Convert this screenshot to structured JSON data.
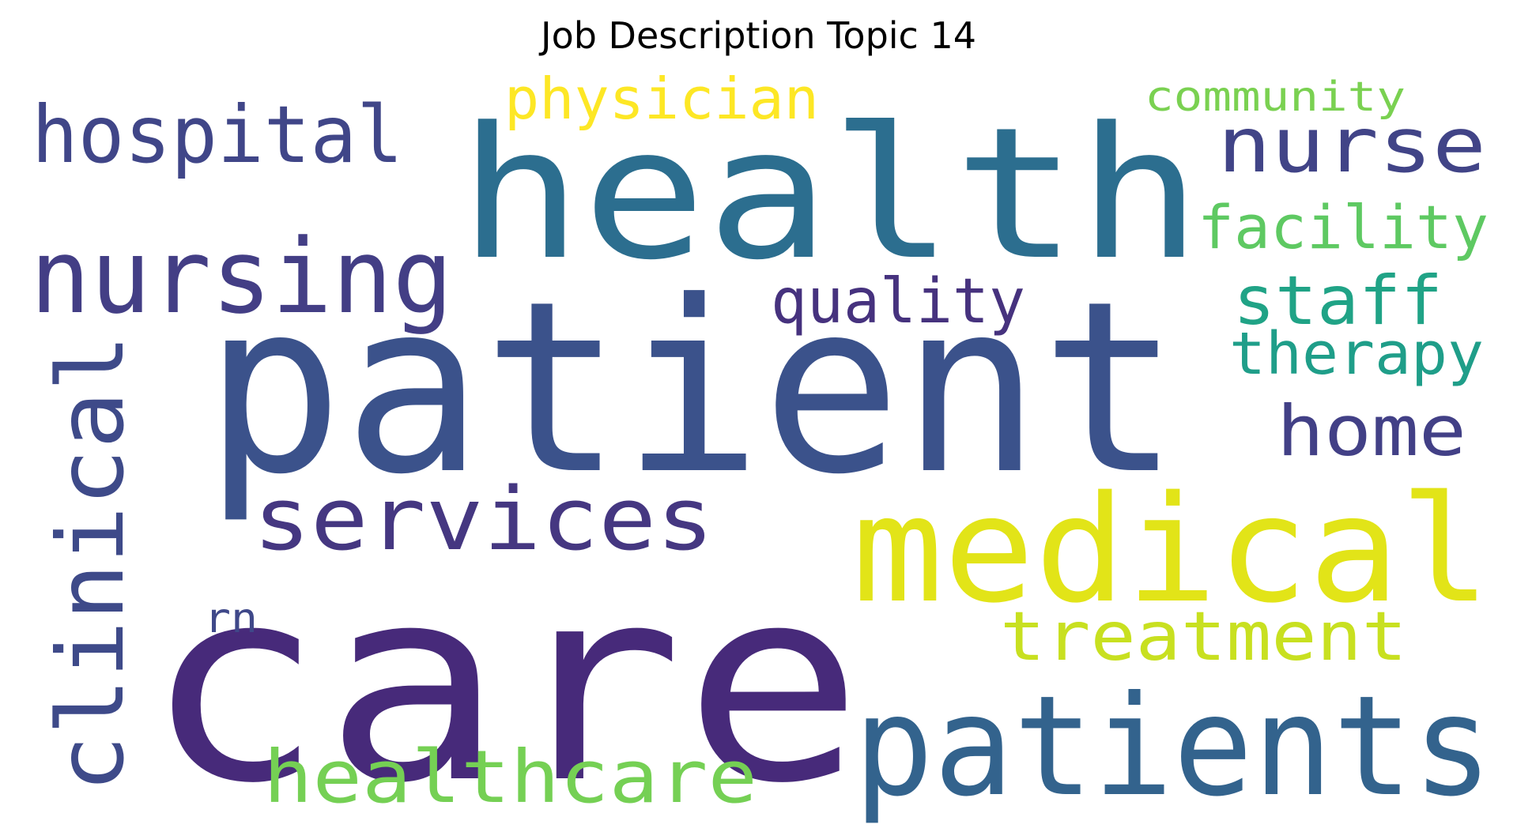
{
  "title": "Job Description Topic 14",
  "words": [
    {
      "text": "care",
      "color": "#472a7a"
    },
    {
      "text": "patient",
      "color": "#3b528b"
    },
    {
      "text": "health",
      "color": "#2c6e8f"
    },
    {
      "text": "medical",
      "color": "#e2e418"
    },
    {
      "text": "patients",
      "color": "#33638d"
    },
    {
      "text": "nursing",
      "color": "#433e85"
    },
    {
      "text": "clinical",
      "color": "#3e4a89"
    },
    {
      "text": "services",
      "color": "#453781"
    },
    {
      "text": "hospital",
      "color": "#404688"
    },
    {
      "text": "nurse",
      "color": "#414487"
    },
    {
      "text": "healthcare",
      "color": "#75d054"
    },
    {
      "text": "treatment",
      "color": "#c8e020"
    },
    {
      "text": "physician",
      "color": "#fde725"
    },
    {
      "text": "home",
      "color": "#424086"
    },
    {
      "text": "facility",
      "color": "#5ec962"
    },
    {
      "text": "staff",
      "color": "#20a386"
    },
    {
      "text": "therapy",
      "color": "#1f9e89"
    },
    {
      "text": "quality",
      "color": "#46327e"
    },
    {
      "text": "community",
      "color": "#7ad151"
    },
    {
      "text": "rn",
      "color": "#3f4889"
    }
  ]
}
